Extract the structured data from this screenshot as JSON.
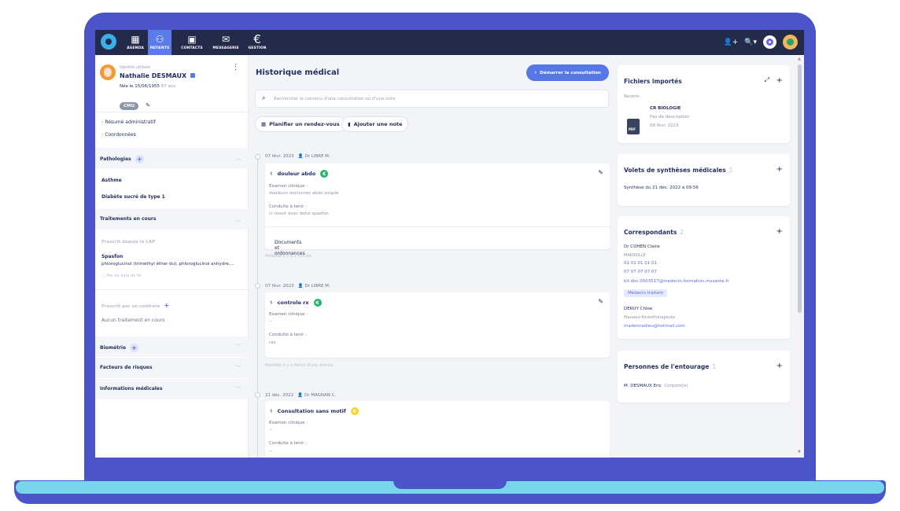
{
  "topbar": {
    "nav": [
      {
        "label": "AGENDA",
        "icon": "calendar-icon",
        "glyph": "▦"
      },
      {
        "label": "PATIENTS",
        "icon": "patients-icon",
        "glyph": "⚇"
      },
      {
        "label": "CONTACTS",
        "icon": "contacts-icon",
        "glyph": "▣"
      },
      {
        "label": "MESSAGERIE",
        "icon": "mail-icon",
        "glyph": "✉"
      },
      {
        "label": "GESTION",
        "icon": "euro-icon",
        "glyph": "€"
      }
    ]
  },
  "patient": {
    "identity_label": "Identité utilisée",
    "name": "Nathalie DESMAUX",
    "birth": "Née le 15/06/1955",
    "age": "67 ans",
    "badge": "CMU"
  },
  "sidebar": {
    "links": [
      "Résumé administratif",
      "Coordonnées"
    ],
    "pathologies": {
      "title": "Pathologies",
      "items": [
        "Asthme",
        "Diabète sucré de type 1"
      ]
    },
    "treatments": {
      "title": "Traitements en cours",
      "prescribed_lap": "Prescrit depuis le LAP",
      "drug_name": "Spasfon",
      "drug_desc": "phloroglucinol (triméthyl éther du), phloroglucinol anhydre,...",
      "no_end": "Pas de date de fin",
      "prescribed_other": "Prescrit par un confrère",
      "none": "Aucun traitement en cours"
    },
    "biometrie": "Biométrie",
    "risques": "Facteurs de risques",
    "infos": "Informations médicales"
  },
  "middle": {
    "title": "Historique médical",
    "start_button": "Démarrer la consultation",
    "search_placeholder": "Rechercher le contenu d'une consultation ou d'une note",
    "plan_button": "Planifier un rendez-vous",
    "note_button": "Ajouter une note",
    "entries": [
      {
        "date": "07 févr. 2023",
        "doctor": "Dr LIBRE M.",
        "title": "douleur abdo",
        "exam_label": "Examen clinique :",
        "exam_value": "douleurs nocturnes abdo souple",
        "conduct_label": "Conduite à tenir :",
        "conduct_value": "ci revoir avec deha spasfon",
        "docs_label": "Documents et ordonnances",
        "docs_count": "1",
        "modified": "Modifiée il y a 1 minute"
      },
      {
        "date": "07 févr. 2023",
        "doctor": "Dr LIBRE M.",
        "title": "controle rx",
        "exam_label": "Examen clinique :",
        "exam_value": "--",
        "conduct_label": "Conduite à tenir :",
        "conduct_value": "ras",
        "modified": "Modifiée il y a moins d'une minute"
      },
      {
        "date": "21 déc. 2022",
        "doctor": "Dr MAGNAN C.",
        "title": "Consultation sans motif",
        "exam_label": "Examen clinique :",
        "exam_value": "--",
        "conduct_label": "Conduite à tenir :",
        "conduct_value": "--"
      }
    ]
  },
  "right": {
    "files": {
      "title": "Fichiers importés",
      "recent_label": "Récents",
      "file_name": "CR BIOLOGIE",
      "file_desc": "Pas de description",
      "file_date": "08 févr. 2023",
      "pdf": "PDF"
    },
    "syntheses": {
      "title": "Volets de synthèses médicales",
      "count": "1",
      "item": "Synthèse du 21 déc. 2022 à 09:56"
    },
    "correspondants": {
      "title": "Correspondants",
      "count": "2",
      "c1_name": "Dr COHEN Claire",
      "c1_city": "MARSEILLE",
      "c1_phone1": "01 01 01 01 01",
      "c1_phone2": "07 07 07 07 07",
      "c1_email": "kit.doc.0003517@medecin.formation.mssante.fr",
      "c1_tag": "Médecin traitant",
      "c2_name": "DERUY Chloe",
      "c2_role": "Masseur-Kinésithérapeute",
      "c2_email": "madennadieu@hotmail.com"
    },
    "entourage": {
      "title": "Personnes de l'entourage",
      "count": "1",
      "person": "M. DESMAUX Eric",
      "relation": "Conjoint(e)"
    }
  }
}
